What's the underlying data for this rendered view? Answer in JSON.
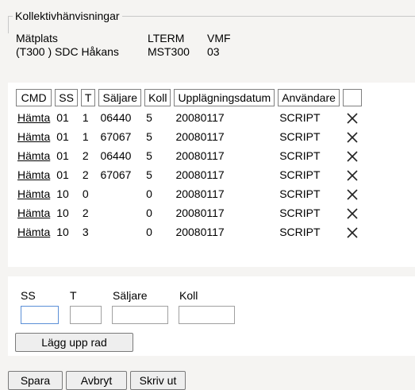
{
  "legend": "Kollektivhänvisningar",
  "info": {
    "col1_label": "Mätplats",
    "col1_value": "(T300 ) SDC Håkans",
    "col2_label": "LTERM",
    "col2_value": "MST300",
    "col3_label": "VMF",
    "col3_value": "03"
  },
  "table": {
    "headers": [
      "CMD",
      "SS",
      "T",
      "Säljare",
      "Koll",
      "Upplägningsdatum",
      "Användare",
      ""
    ],
    "rows": [
      {
        "cmd": "Hämta",
        "ss": "01",
        "t": "1",
        "saljare": "06440",
        "koll": "5",
        "datum": "20080117",
        "anvandare": "SCRIPT"
      },
      {
        "cmd": "Hämta",
        "ss": "01",
        "t": "1",
        "saljare": "67067",
        "koll": "5",
        "datum": "20080117",
        "anvandare": "SCRIPT"
      },
      {
        "cmd": "Hämta",
        "ss": "01",
        "t": "2",
        "saljare": "06440",
        "koll": "5",
        "datum": "20080117",
        "anvandare": "SCRIPT"
      },
      {
        "cmd": "Hämta",
        "ss": "01",
        "t": "2",
        "saljare": "67067",
        "koll": "5",
        "datum": "20080117",
        "anvandare": "SCRIPT"
      },
      {
        "cmd": "Hämta",
        "ss": "10",
        "t": "0",
        "saljare": "",
        "koll": "0",
        "datum": "20080117",
        "anvandare": "SCRIPT"
      },
      {
        "cmd": "Hämta",
        "ss": "10",
        "t": "2",
        "saljare": "",
        "koll": "0",
        "datum": "20080117",
        "anvandare": "SCRIPT"
      },
      {
        "cmd": "Hämta",
        "ss": "10",
        "t": "3",
        "saljare": "",
        "koll": "0",
        "datum": "20080117",
        "anvandare": "SCRIPT"
      }
    ],
    "delete_icon": "close-x-icon"
  },
  "add_form": {
    "ss_label": "SS",
    "t_label": "T",
    "saljare_label": "Säljare",
    "koll_label": "Koll",
    "ss_value": "",
    "t_value": "",
    "saljare_value": "",
    "koll_value": "",
    "add_button": "Lägg upp rad"
  },
  "footer": {
    "save": "Spara",
    "cancel": "Avbryt",
    "print": "Skriv ut"
  }
}
